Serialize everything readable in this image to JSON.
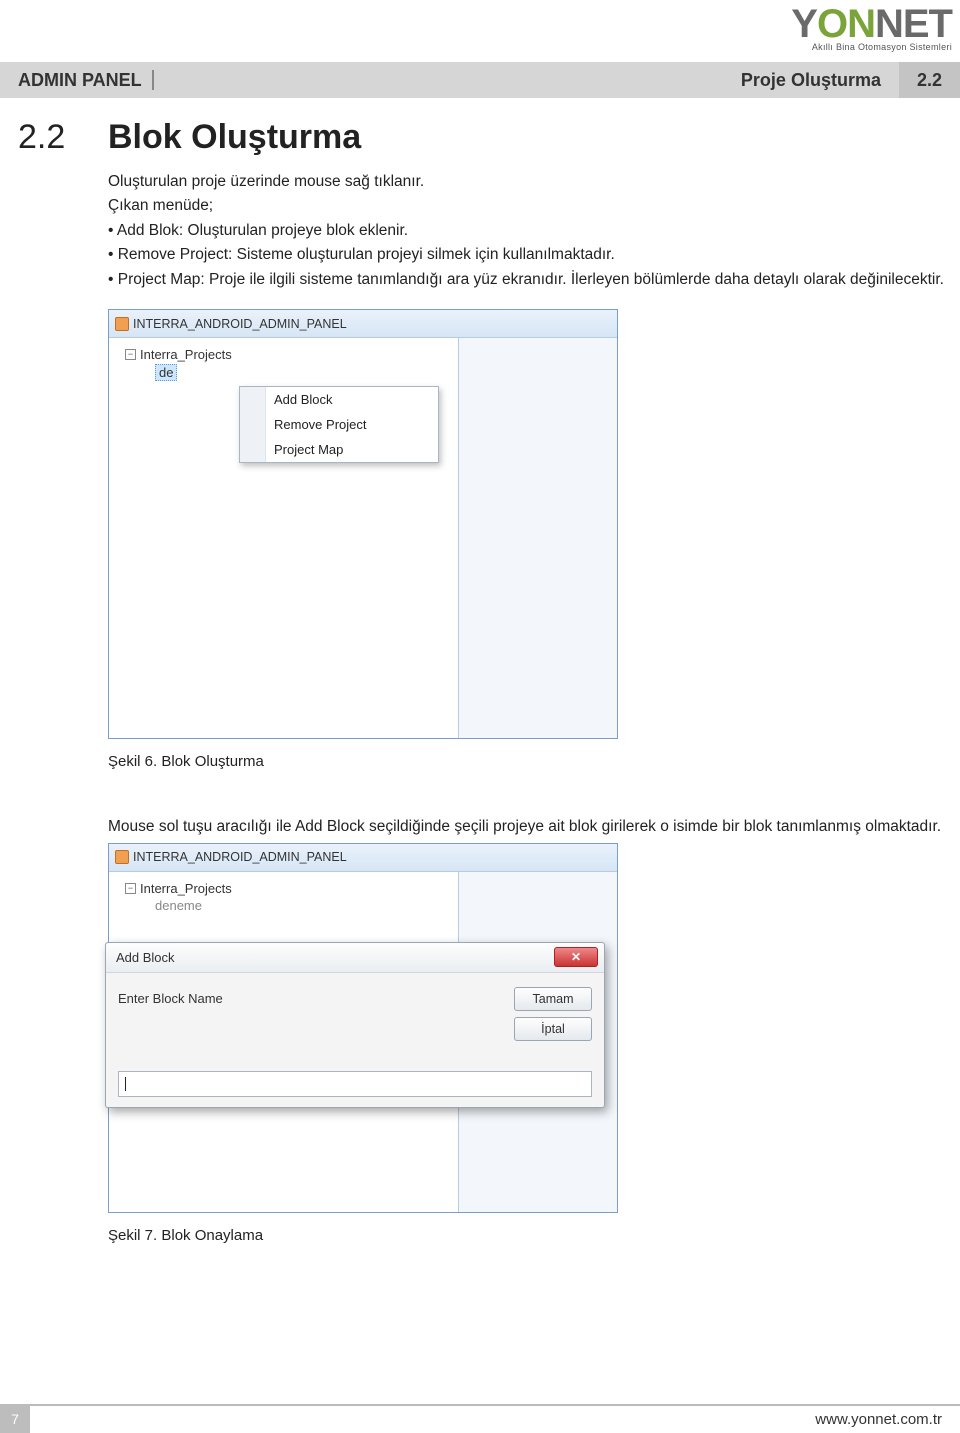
{
  "logo": {
    "brand_pre": "Y",
    "brand_o1": "O",
    "brand_n1": "N",
    "brand_n2": "N",
    "brand_post": "ET",
    "tagline": "Akıllı Bina Otomasyon Sistemleri"
  },
  "header": {
    "left": "ADMIN PANEL",
    "right_title": "Proje Oluşturma",
    "right_num": "2.2"
  },
  "section": {
    "num": "2.2",
    "title": "Blok Oluşturma"
  },
  "para": {
    "l1": "Oluşturulan proje üzerinde mouse sağ tıklanır.",
    "l2": "Çıkan menüde;",
    "l3": "• Add Blok: Oluşturulan projeye blok eklenir.",
    "l4": "• Remove Project: Sisteme oluşturulan projeyi silmek için kullanılmaktadır.",
    "l5": "• Project Map: Proje ile ilgili sisteme tanımlandığı ara yüz ekranıdır. İlerleyen bölümlerde daha detaylı olarak değinilecektir."
  },
  "shot1": {
    "title": "INTERRA_ANDROID_ADMIN_PANEL",
    "tree_root": "Interra_Projects",
    "tree_child_prefix": "de",
    "menu": {
      "i1": "Add Block",
      "i2": "Remove Project",
      "i3": "Project Map"
    }
  },
  "caption1": "Şekil 6. Blok Oluşturma",
  "para2": "Mouse sol tuşu aracılığı ile Add Block seçildiğinde şeçili projeye ait blok girilerek o isimde bir blok tanımlanmış olmaktadır.",
  "shot2": {
    "title": "INTERRA_ANDROID_ADMIN_PANEL",
    "tree_root": "Interra_Projects",
    "tree_child": "deneme",
    "dialog_title": "Add Block",
    "label": "Enter Block Name",
    "btn_ok": "Tamam",
    "btn_cancel": "İptal"
  },
  "caption2": "Şekil 7. Blok Onaylama",
  "footer": {
    "page": "7",
    "url": "www.yonnet.com.tr"
  }
}
